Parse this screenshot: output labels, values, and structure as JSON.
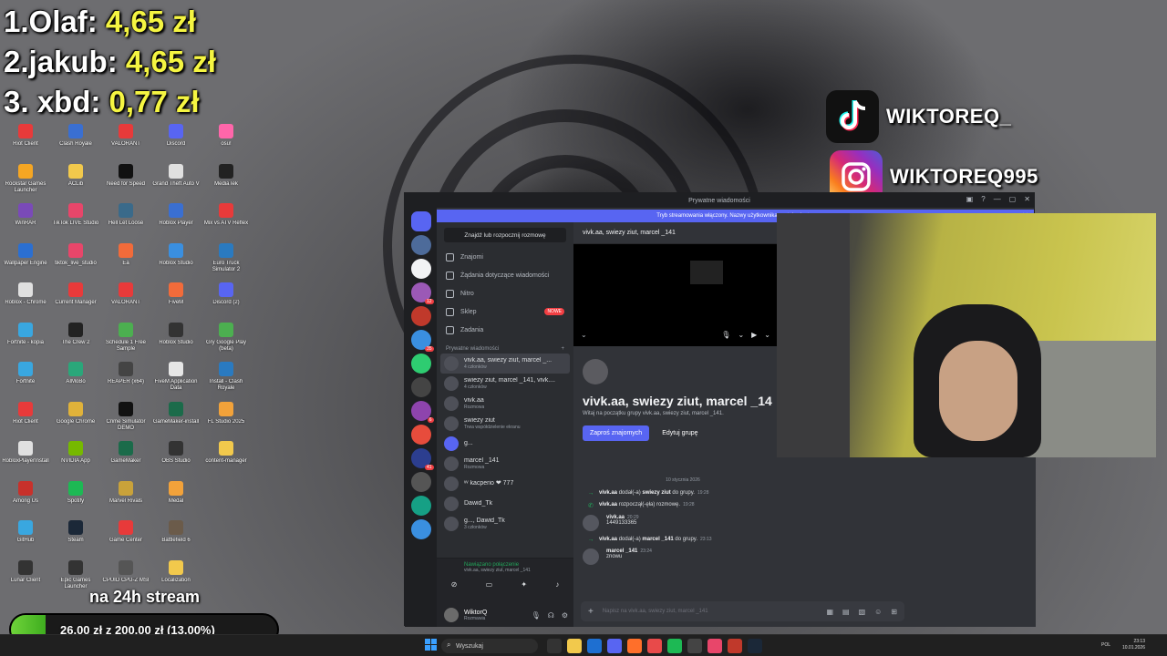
{
  "leaderboard": [
    {
      "name": "1.Olaf: ",
      "amount": "4,65 zł"
    },
    {
      "name": "2.jakub: ",
      "amount": "4,65 zł"
    },
    {
      "name": "3. xbd: ",
      "amount": "0,77 zł"
    }
  ],
  "socials": {
    "tiktok": "WIKTOREQ_",
    "instagram": "WIKTOREQ995"
  },
  "desktop_icons": [
    {
      "label": "Riot Client",
      "color": "#e83a3a"
    },
    {
      "label": "Rockstar Games Launcher",
      "color": "#f5a623"
    },
    {
      "label": "WinRAR",
      "color": "#7a4ab8"
    },
    {
      "label": "Wallpaper Engine",
      "color": "#2b6fd1"
    },
    {
      "label": "Roblox - Chrome",
      "color": "#e0e0e0"
    },
    {
      "label": "Fortnite - kopia",
      "color": "#39a7e0"
    },
    {
      "label": "Fortnite",
      "color": "#39a7e0"
    },
    {
      "label": "Riot Client",
      "color": "#e83a3a"
    },
    {
      "label": "RobloxPlayerInstall",
      "color": "#e0e0e0"
    },
    {
      "label": "Among Us",
      "color": "#c8312b"
    },
    {
      "label": "GitHub",
      "color": "#39a7e0"
    },
    {
      "label": "Lunar Client",
      "color": "#333"
    },
    {
      "label": "Clash Royale",
      "color": "#3a6fd1"
    },
    {
      "label": "ACLib",
      "color": "#f2c94c"
    },
    {
      "label": "TikTok LIVE Studio",
      "color": "#e8466a"
    },
    {
      "label": "tiktok_live_studio",
      "color": "#e8466a"
    },
    {
      "label": "Current Manager",
      "color": "#e83a3a"
    },
    {
      "label": "The Crew 2",
      "color": "#222"
    },
    {
      "label": "AIMoBo",
      "color": "#2aa77a"
    },
    {
      "label": "Google Chrome",
      "color": "#e0b23a"
    },
    {
      "label": "NVIDIA App",
      "color": "#76b900"
    },
    {
      "label": "Spotify",
      "color": "#1db954"
    },
    {
      "label": "Steam",
      "color": "#1b2838"
    },
    {
      "label": "Epic Games Launcher",
      "color": "#333"
    },
    {
      "label": "VALORANT",
      "color": "#e83a3a"
    },
    {
      "label": "Need for Speed",
      "color": "#111"
    },
    {
      "label": "Hell Let Loose",
      "color": "#3a6a8a"
    },
    {
      "label": "Ea",
      "color": "#f26b3a"
    },
    {
      "label": "VALORANT",
      "color": "#e83a3a"
    },
    {
      "label": "Schedule 1 Free Sample",
      "color": "#4caf50"
    },
    {
      "label": "REAPER (x64)",
      "color": "#444"
    },
    {
      "label": "Crime Simulator DEMO",
      "color": "#111"
    },
    {
      "label": "GameMaker",
      "color": "#1b6b4a"
    },
    {
      "label": "Marvel Rivals",
      "color": "#c9a23a"
    },
    {
      "label": "Game Center",
      "color": "#e83a3a"
    },
    {
      "label": "CPUID CPU-Z MSI",
      "color": "#555"
    },
    {
      "label": "Discord",
      "color": "#5865f2"
    },
    {
      "label": "Grand Theft Auto V",
      "color": "#e0e0e0"
    },
    {
      "label": "Roblox Player",
      "color": "#3a6fd1"
    },
    {
      "label": "Roblox Studio",
      "color": "#3a8fe0"
    },
    {
      "label": "FiveM",
      "color": "#f26b3a"
    },
    {
      "label": "Roblox Studio",
      "color": "#333"
    },
    {
      "label": "FiveM Application Data",
      "color": "#e6e6e6"
    },
    {
      "label": "GameMaker-install",
      "color": "#1b6b4a"
    },
    {
      "label": "OBS Studio",
      "color": "#333"
    },
    {
      "label": "Medal",
      "color": "#f2a23a"
    },
    {
      "label": "Battlefield 6",
      "color": "#6b5b4a"
    },
    {
      "label": "Localization",
      "color": "#f2c94c"
    },
    {
      "label": "osu!",
      "color": "#ff66aa"
    },
    {
      "label": "MediaTek",
      "color": "#222"
    },
    {
      "label": "Mix vs ATV Reflex",
      "color": "#e83a3a"
    },
    {
      "label": "Euro Truck Simulator 2",
      "color": "#2a7ac0"
    },
    {
      "label": "Discord (2)",
      "color": "#5865f2"
    },
    {
      "label": "Gry Google Play (beta)",
      "color": "#4caf50"
    },
    {
      "label": "Install - Clash Royale",
      "color": "#2a7ac0"
    },
    {
      "label": "FL Studio 2025",
      "color": "#f2a23a"
    },
    {
      "label": "content-manager",
      "color": "#f2c94c"
    }
  ],
  "discord": {
    "window_title": "Prywatne wiadomości",
    "banner": "Tryb streamowania włączony. Nazwy użytkownika zostały ukryte.",
    "search_conversation": "Znajdź lub rozpocznij rozmowę",
    "nav": [
      {
        "label": "Znajomi"
      },
      {
        "label": "Żądania dotyczące wiadomości"
      },
      {
        "label": "Nitro"
      },
      {
        "label": "Sklep",
        "badge": "NOWE"
      },
      {
        "label": "Zadania"
      }
    ],
    "dm_header": "Prywatne wiadomości",
    "dm_add": "+",
    "dms": [
      {
        "title": "vivk.aa, swiezy ziut, marcel _...",
        "sub": "4 członków"
      },
      {
        "title": "swiezy ziut, marcel _141, vivk....",
        "sub": "4 członków"
      },
      {
        "title": "vivk.aa",
        "sub": "Rozmowa"
      },
      {
        "title": "swiezy ziut",
        "sub": "Trwa współdzielenie ekranu"
      },
      {
        "title": "g...",
        "sub": ""
      },
      {
        "title": "marcel _141",
        "sub": "Rozmowa"
      },
      {
        "title": "ᵛᵛ kacperio ❤ 777",
        "sub": ""
      },
      {
        "title": "Dawid_Tk",
        "sub": ""
      },
      {
        "title": "g..., Dawid_Tk",
        "sub": "3 członków"
      }
    ],
    "voice": {
      "status": "Nawiązano połączenie",
      "channel": "vivk.aa, swiezy ziut, marcel _141"
    },
    "user": {
      "name": "WiktorQ",
      "status": "Rozmawia"
    },
    "channel_header": "vivk.aa, swiezy ziut, marcel _141",
    "group_name": "vivk.aa, swiezy ziut, marcel _14",
    "group_welcome": "Witaj na początku grupy vivk.aa, swiezy ziut, marcel _141.",
    "invite_button": "Zaproś znajomych",
    "edit_button": "Edytuj grupę",
    "date_divider": "10 stycznia 2026",
    "messages": [
      {
        "kind": "system",
        "user": "vivk.aa",
        "text": " dodał(-a) ",
        "target": "swiezy ziut",
        "tail": " do grupy.",
        "time": "19:28"
      },
      {
        "kind": "system",
        "user": "vivk.aa",
        "text": " rozpoczął(-ęła) rozmowę.",
        "target": "",
        "tail": "",
        "time": "19:28"
      },
      {
        "kind": "msg",
        "user": "vivk.aa",
        "text": "1449133365",
        "time": "20:29"
      },
      {
        "kind": "system",
        "user": "vivk.aa",
        "text": " dodał(-a) ",
        "target": "marcel _141",
        "tail": " do grupy.",
        "time": "23:13"
      },
      {
        "kind": "msg",
        "user": "marcel _141",
        "text": "znowu",
        "time": "23:24"
      }
    ],
    "composer_placeholder": "Napisz na vivk.aa, swiezy ziut, marcel _141"
  },
  "goal": {
    "title": "na 24h stream",
    "text": "26,00 zł z 200,00 zł (13.00%)",
    "progress": 0.13
  },
  "taskbar": {
    "search": "Wyszukaj",
    "lang": "POL",
    "time": "23:13",
    "date": "10.01.2026"
  }
}
